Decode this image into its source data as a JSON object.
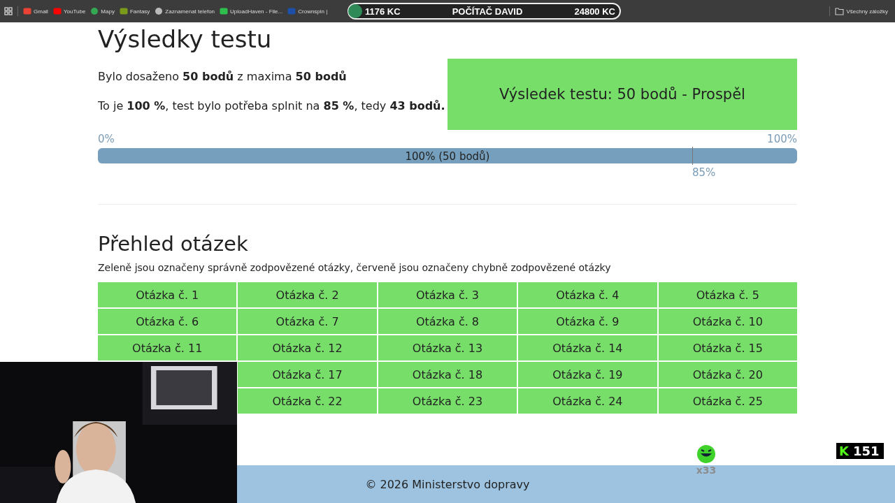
{
  "bookmarks_bar": {
    "items": [
      {
        "label": "Gmail"
      },
      {
        "label": "YouTube"
      },
      {
        "label": "Mapy"
      },
      {
        "label": "Fantasy"
      },
      {
        "label": "Zaznamenat telefon"
      },
      {
        "label": "UploadHaven - File..."
      },
      {
        "label": "Crownspin |"
      }
    ],
    "all_bookmarks": "Všechny záložky"
  },
  "stream_scorebar": {
    "left_score": "1176 KC",
    "name": "POČÍTAČ DAVID",
    "right_score": "24800 KC"
  },
  "results": {
    "title": "Výsledky testu",
    "lines": [
      "Bylo dosaženo **50 bodů** z maxima **50 bodů**",
      "To je **100 %**, test bylo potřeba splnit na **85 %**, tedy **43 bodů.**"
    ],
    "verdict": {
      "text": "Výsledek testu: 50 bodů - Prospěl",
      "passed": true
    },
    "progress": {
      "min_label": "0%",
      "max_label": "100%",
      "level": 1,
      "bar_label": "100% (50 bodů)",
      "threshold": {
        "label": "85%",
        "level": 0.85
      }
    }
  },
  "overview": {
    "title": "Přehled otázek",
    "description": "Zeleně jsou označeny správně zodpovězené otázky, červeně jsou označeny chybně zodpovězené otázky",
    "rows": [
      {
        "cells": [
          {
            "label": "Otázka č. 1",
            "correct": true
          },
          {
            "label": "Otázka č. 2",
            "correct": true
          },
          {
            "label": "Otázka č. 3",
            "correct": true
          },
          {
            "label": "Otázka č. 4",
            "correct": true
          },
          {
            "label": "Otázka č. 5",
            "correct": true
          }
        ]
      },
      {
        "cells": [
          {
            "label": "Otázka č. 6",
            "correct": true
          },
          {
            "label": "Otázka č. 7",
            "correct": true
          },
          {
            "label": "Otázka č. 8",
            "correct": true
          },
          {
            "label": "Otázka č. 9",
            "correct": true
          },
          {
            "label": "Otázka č. 10",
            "correct": true
          }
        ]
      },
      {
        "cells": [
          {
            "label": "Otázka č. 11",
            "correct": true
          },
          {
            "label": "Otázka č. 12",
            "correct": true
          },
          {
            "label": "Otázka č. 13",
            "correct": true
          },
          {
            "label": "Otázka č. 14",
            "correct": true
          },
          {
            "label": "Otázka č. 15",
            "correct": true
          }
        ]
      },
      {
        "cells": [
          {
            "label": "Otázka č. 17",
            "correct": true
          },
          {
            "label": "Otázka č. 18",
            "correct": true
          },
          {
            "label": "Otázka č. 19",
            "correct": true
          },
          {
            "label": "Otázka č. 20",
            "correct": true
          }
        ]
      },
      {
        "cells": [
          {
            "label": "Otázka č. 22",
            "correct": true
          },
          {
            "label": "Otázka č. 23",
            "correct": true
          },
          {
            "label": "Otázka č. 24",
            "correct": true
          },
          {
            "label": "Otázka č. 25",
            "correct": true
          }
        ]
      }
    ]
  },
  "footer": {
    "text": "© 2026 Ministerstvo dopravy"
  },
  "stream_overlay": {
    "emote_count": "x33",
    "badge": {
      "logo": "K",
      "count": "151"
    }
  }
}
